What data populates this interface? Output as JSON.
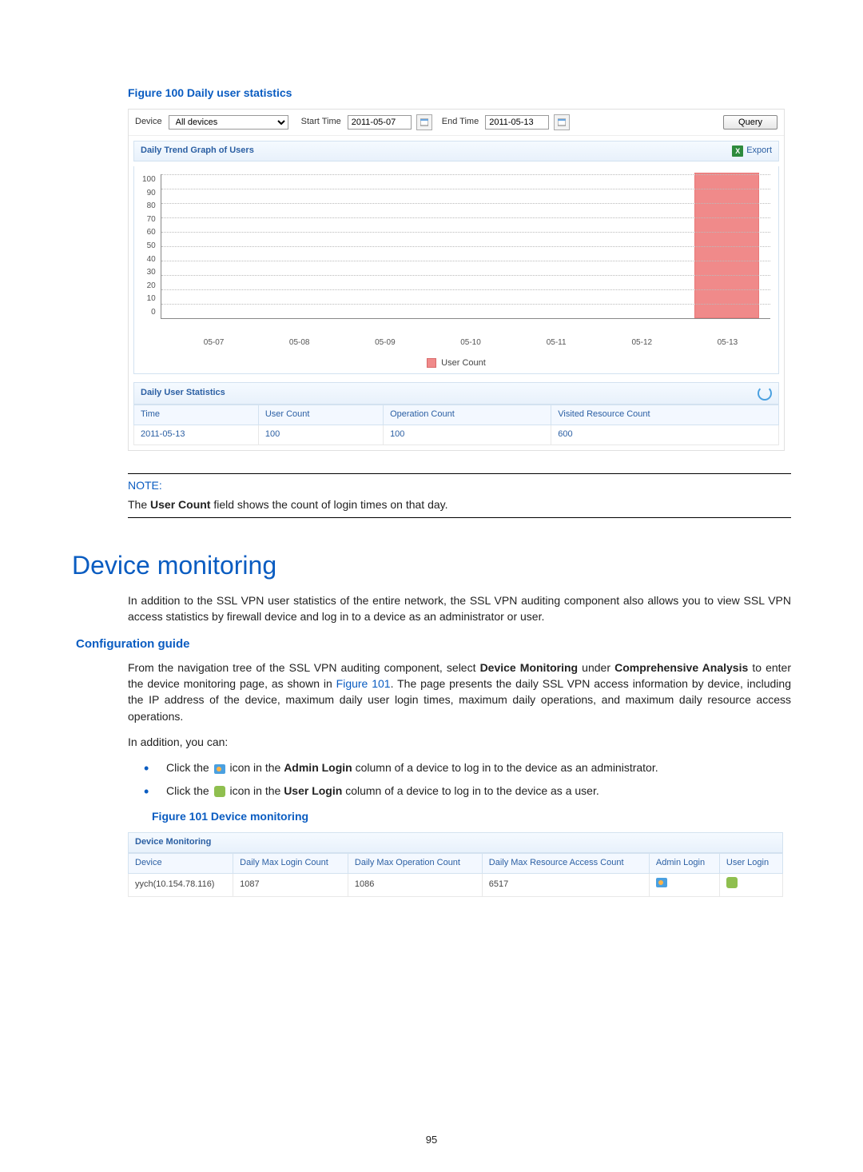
{
  "fig100": {
    "caption": "Figure 100 Daily user statistics",
    "filter": {
      "device_label": "Device",
      "device_value": "All devices",
      "start_label": "Start Time",
      "start_value": "2011-05-07",
      "end_label": "End Time",
      "end_value": "2011-05-13",
      "query_label": "Query"
    },
    "trend_title": "Daily Trend Graph of Users",
    "export_label": "Export",
    "legend_label": "User Count",
    "stats_title": "Daily User Statistics",
    "stats_headers": {
      "time": "Time",
      "user_count": "User Count",
      "op_count": "Operation Count",
      "vr_count": "Visited Resource Count"
    },
    "stats_row": {
      "time": "2011-05-13",
      "user_count": "100",
      "op_count": "100",
      "vr_count": "600"
    }
  },
  "note": {
    "label": "NOTE:",
    "prefix": "The ",
    "bold": "User Count",
    "suffix": " field shows the count of login times on that day."
  },
  "section": {
    "title": "Device monitoring",
    "intro": "In addition to the SSL VPN user statistics of the entire network, the SSL VPN auditing component also allows you to view SSL VPN access statistics by firewall device and log in to a device as an administrator or user.",
    "config_head": "Configuration guide",
    "para1_a": "From the navigation tree of the SSL VPN auditing component, select ",
    "para1_b1": "Device Monitoring",
    "para1_c": " under ",
    "para1_b2": "Comprehensive Analysis",
    "para1_d": " to enter the device monitoring page, as shown in ",
    "para1_link": "Figure 101",
    "para1_e": ". The page presents the daily SSL VPN access information by device, including the IP address of the device, maximum daily user login times, maximum daily operations, and maximum daily resource access operations.",
    "para2": "In addition, you can:",
    "bullet1_a": "Click the ",
    "bullet1_b": " icon in the ",
    "bullet1_bold": "Admin Login",
    "bullet1_c": " column of a device to log in to the device as an administrator.",
    "bullet2_a": "Click the ",
    "bullet2_b": " icon in the ",
    "bullet2_bold": "User Login",
    "bullet2_c": " column of a device to log in to the device as a user."
  },
  "fig101": {
    "caption": "Figure 101 Device monitoring",
    "title": "Device Monitoring",
    "headers": {
      "device": "Device",
      "login": "Daily Max Login Count",
      "op": "Daily Max Operation Count",
      "res": "Daily Max Resource Access Count",
      "admin": "Admin Login",
      "user": "User Login"
    },
    "row": {
      "device": "yych(10.154.78.116)",
      "login": "1087",
      "op": "1086",
      "res": "6517"
    }
  },
  "page_number": "95",
  "chart_data": {
    "type": "bar",
    "title": "Daily Trend Graph of Users",
    "xlabel": "",
    "ylabel": "",
    "ylim": [
      0,
      100
    ],
    "y_ticks": [
      100,
      90,
      80,
      70,
      60,
      50,
      40,
      30,
      20,
      10,
      0
    ],
    "categories": [
      "05-07",
      "05-08",
      "05-09",
      "05-10",
      "05-11",
      "05-12",
      "05-13"
    ],
    "series": [
      {
        "name": "User Count",
        "values": [
          0,
          0,
          0,
          0,
          0,
          0,
          100
        ],
        "color": "#f08a8a"
      }
    ]
  }
}
